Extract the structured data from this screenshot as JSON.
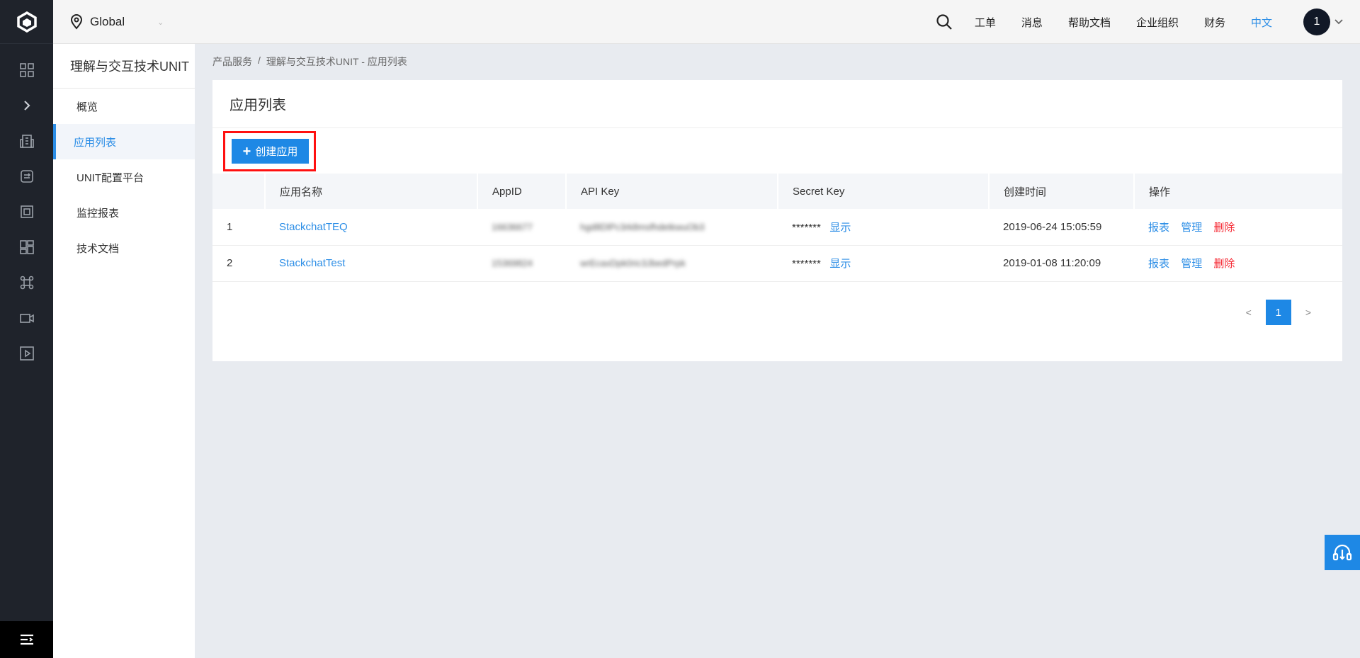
{
  "topbar": {
    "region": "Global",
    "nav": [
      "工单",
      "消息",
      "帮助文档",
      "企业组织",
      "财务"
    ],
    "lang": "中文",
    "avatar": "1"
  },
  "sidebar": {
    "title": "理解与交互技术UNIT",
    "items": [
      {
        "label": "概览",
        "active": false
      },
      {
        "label": "应用列表",
        "active": true
      },
      {
        "label": "UNIT配置平台",
        "active": false
      },
      {
        "label": "监控报表",
        "active": false
      },
      {
        "label": "技术文档",
        "active": false
      }
    ]
  },
  "breadcrumb": {
    "root": "产品服务",
    "sep": "/",
    "current": "理解与交互技术UNIT - 应用列表"
  },
  "panel": {
    "title": "应用列表",
    "create_label": "创建应用",
    "columns": [
      "",
      "应用名称",
      "AppID",
      "API Key",
      "Secret Key",
      "创建时间",
      "操作"
    ],
    "rows": [
      {
        "index": "1",
        "name": "StackchatTEQ",
        "appid": "16636677",
        "apikey": "hgd8DlPc3rk8msfhdetkwuOb3",
        "secret_mask": "*******",
        "secret_show": "显示",
        "created": "2019-06-24 15:05:59"
      },
      {
        "index": "2",
        "name": "StackchatTest",
        "appid": "15369824",
        "apikey": "wrEcaxDpk0ric3JbedPrpk",
        "secret_mask": "*******",
        "secret_show": "显示",
        "created": "2019-01-08 11:20:09"
      }
    ],
    "actions": {
      "report": "报表",
      "manage": "管理",
      "delete": "删除"
    },
    "pager": {
      "prev": "<",
      "page": "1",
      "next": ">"
    }
  },
  "colors": {
    "accent": "#1e88e5",
    "link": "#2b8de6",
    "danger": "#f5222d",
    "highlight_box": "#ff1010",
    "rail": "#1f232b"
  },
  "icons": {
    "rail": [
      "logo-icon",
      "grid-icon",
      "expand-chevron-icon",
      "building-icon",
      "database-icon",
      "server-icon",
      "dashboard-icon",
      "command-icon",
      "video-icon",
      "play-icon",
      "menu-icon"
    ],
    "top": [
      "location-pin-icon",
      "search-icon",
      "chevron-down-icon"
    ],
    "support": "headset-icon"
  }
}
